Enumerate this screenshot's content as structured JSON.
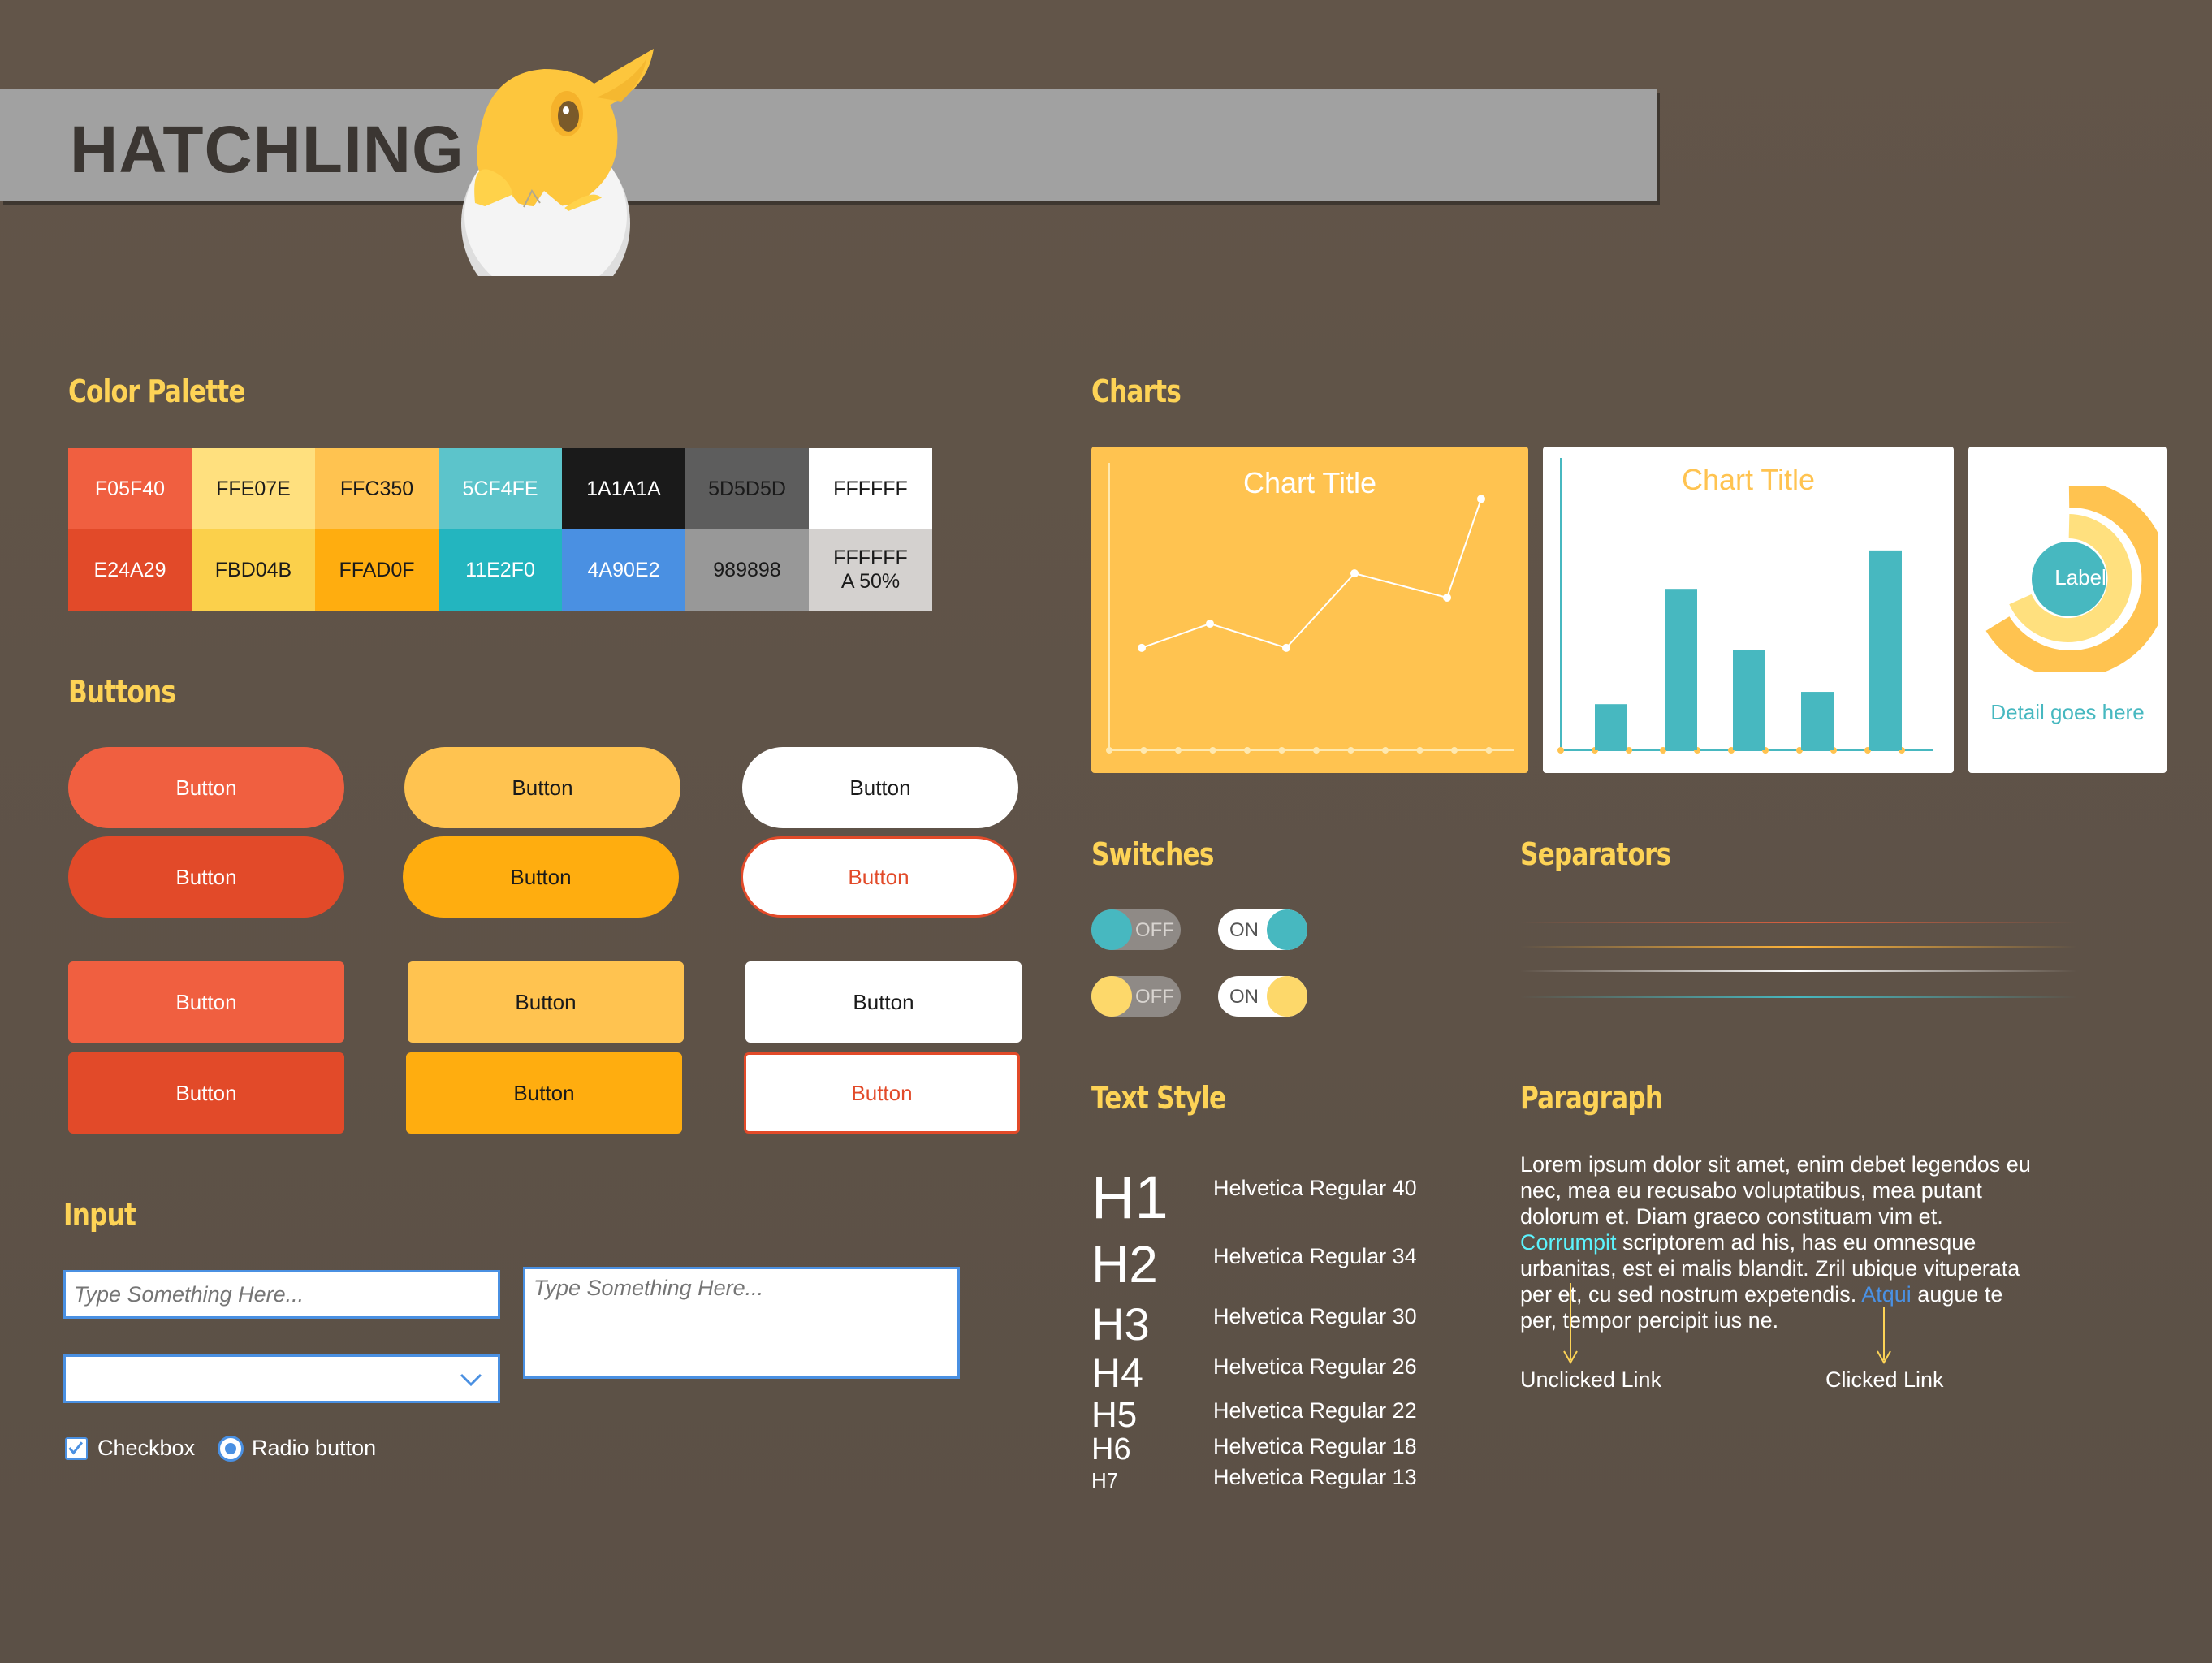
{
  "brand": {
    "title": "HATCHLING"
  },
  "sections": {
    "palette": "Color Palette",
    "buttons": "Buttons",
    "input": "Input",
    "charts": "Charts",
    "switches": "Switches",
    "separators": "Separators",
    "text_style": "Text Style",
    "paragraph": "Paragraph"
  },
  "palette": {
    "row1": [
      {
        "label": "F05F40",
        "color": "#F05F40",
        "text": "#ffffff"
      },
      {
        "label": "FFE07E",
        "color": "#FFE07E",
        "text": "#1a1a1a"
      },
      {
        "label": "FFC350",
        "color": "#FFC350",
        "text": "#1a1a1a"
      },
      {
        "label": "5CF4FE",
        "color": "#5CC4CB",
        "text": "#ffffff"
      },
      {
        "label": "1A1A1A",
        "color": "#1A1A1A",
        "text": "#ffffff"
      },
      {
        "label": "5D5D5D",
        "color": "#5D5D5D",
        "text": "#1a1a1a"
      },
      {
        "label": "FFFFFF",
        "color": "#FFFFFF",
        "text": "#1a1a1a"
      }
    ],
    "row2": [
      {
        "label": "E24A29",
        "color": "#E24A29",
        "text": "#ffffff"
      },
      {
        "label": "FBD04B",
        "color": "#FBD04B",
        "text": "#1a1a1a"
      },
      {
        "label": "FFAD0F",
        "color": "#FFAD0F",
        "text": "#1a1a1a"
      },
      {
        "label": "11E2F0",
        "color": "#23B5BF",
        "text": "#ffffff"
      },
      {
        "label": "4A90E2",
        "color": "#4A90E2",
        "text": "#ffffff"
      },
      {
        "label": "989898",
        "color": "#989898",
        "text": "#1a1a1a"
      },
      {
        "label": "FFFFFF\nA 50%",
        "color": "#D4D1CF",
        "text": "#1a1a1a"
      }
    ]
  },
  "buttons": {
    "label": "Button"
  },
  "inputs": {
    "text_placeholder": "Type Something Here...",
    "textarea_placeholder": "Type Something Here...",
    "select_value": "",
    "checkbox_label": "Checkbox",
    "radio_label": "Radio button"
  },
  "charts": {
    "line_title": "Chart Title",
    "bar_title": "Chart Title",
    "donut_label": "Label",
    "donut_detail": "Detail goes here"
  },
  "chart_data": [
    {
      "type": "line",
      "title": "Chart Title",
      "x": [
        1,
        2,
        3,
        4,
        5,
        6
      ],
      "y": [
        5.5,
        6.8,
        5.5,
        9.5,
        8.2,
        13.5
      ],
      "ylim": [
        0,
        15
      ],
      "grid": false
    },
    {
      "type": "bar",
      "title": "Chart Title",
      "values": [
        3,
        10.5,
        6.5,
        3.8,
        13
      ],
      "ylim": [
        0,
        15
      ]
    },
    {
      "type": "pie",
      "values": [
        70,
        30
      ],
      "labels": [
        "Label"
      ]
    }
  ],
  "switches": [
    {
      "state": "OFF",
      "knob": "#47b8c0"
    },
    {
      "state": "ON",
      "knob": "#47b8c0"
    },
    {
      "state": "OFF",
      "knob": "#fdd86a"
    },
    {
      "state": "ON",
      "knob": "#fdd86a"
    }
  ],
  "text_style": [
    {
      "tag": "H1",
      "desc": "Helvetica Regular 40"
    },
    {
      "tag": "H2",
      "desc": "Helvetica Regular 34"
    },
    {
      "tag": "H3",
      "desc": "Helvetica Regular 30"
    },
    {
      "tag": "H4",
      "desc": "Helvetica Regular 26"
    },
    {
      "tag": "H5",
      "desc": "Helvetica Regular 22"
    },
    {
      "tag": "H6",
      "desc": "Helvetica Regular 18"
    },
    {
      "tag": "H7",
      "desc": "Helvetica Regular 13"
    }
  ],
  "paragraph": {
    "p1": "Lorem ipsum dolor sit amet, enim debet legendos eu nec, mea eu recusabo voluptatibus, mea putant dolorum et. Diam graeco constituam vim et.",
    "link1": "Corrumpit",
    "p2": " scriptorem ad his, has eu omnesque urbanitas, est ei malis blandit. Zril ubique vituperata per et, cu sed nostrum expetendis.",
    "link2": "Atqui",
    "p3": " augue te per, tempor percipit ius ne.",
    "unclicked_label": "Unclicked Link",
    "clicked_label": "Clicked Link"
  }
}
